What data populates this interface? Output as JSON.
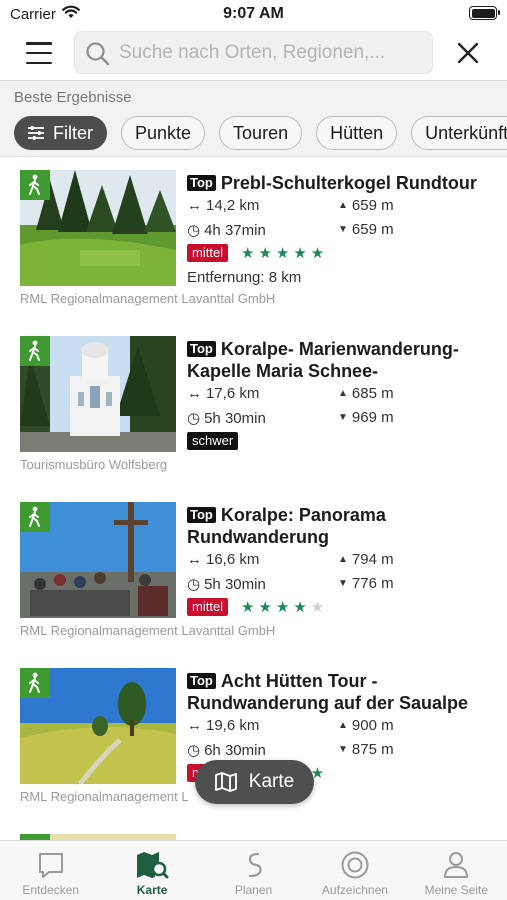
{
  "status": {
    "carrier": "Carrier",
    "time": "9:07 AM"
  },
  "search": {
    "placeholder": "Suche nach Orten, Regionen,..."
  },
  "results_label": "Beste Ergebnisse",
  "chips": [
    {
      "label": "Filter",
      "icon": "sliders-icon"
    },
    {
      "label": "Punkte"
    },
    {
      "label": "Touren"
    },
    {
      "label": "Hütten"
    },
    {
      "label": "Unterkünfte"
    }
  ],
  "top_label": "Top",
  "items": [
    {
      "title": "Prebl-Schulterkogel Rundtour",
      "distance": "14,2 km",
      "duration": "4h 37min",
      "ascent": "659 m",
      "descent": "659 m",
      "difficulty": "mittel",
      "rating": 5,
      "proximity": "Entfernung: 8 km",
      "source": "RML Regionalmanagement Lavanttal GmbH"
    },
    {
      "title": "Koralpe- Marienwanderung-Kapelle Maria Schnee-",
      "distance": "17,6 km",
      "duration": "5h 30min",
      "ascent": "685 m",
      "descent": "969 m",
      "difficulty": "schwer",
      "source": "Tourismusbüro Wolfsberg"
    },
    {
      "title": "Koralpe: Panorama Rundwanderung",
      "distance": "16,6 km",
      "duration": "5h 30min",
      "ascent": "794 m",
      "descent": "776 m",
      "difficulty": "mittel",
      "rating": 4,
      "source": "RML Regionalmanagement Lavanttal GmbH"
    },
    {
      "title": "Acht Hütten Tour - Rundwanderung auf der Saualpe",
      "distance": "19,6 km",
      "duration": "6h 30min",
      "ascent": "900 m",
      "descent": "875 m",
      "difficulty": "mittel",
      "source": "RML Regionalmanagement L"
    }
  ],
  "map_button": {
    "label": "Karte",
    "icon": "map-icon"
  },
  "tabs": [
    {
      "label": "Entdecken",
      "icon": "speech-bubble-icon",
      "active": false
    },
    {
      "label": "Karte",
      "icon": "map-search-icon",
      "active": true
    },
    {
      "label": "Planen",
      "icon": "route-icon",
      "active": false
    },
    {
      "label": "Aufzeichnen",
      "icon": "record-icon",
      "active": false
    },
    {
      "label": "Meine Seite",
      "icon": "person-icon",
      "active": false
    }
  ],
  "colors": {
    "accent_green": "#1d8a57",
    "active_tab": "#1d5f3f",
    "hike_badge": "#3f9a32",
    "difficulty_mittel": "#c8102e",
    "difficulty_schwer": "#111111",
    "chip_active": "#4d4d4f"
  }
}
